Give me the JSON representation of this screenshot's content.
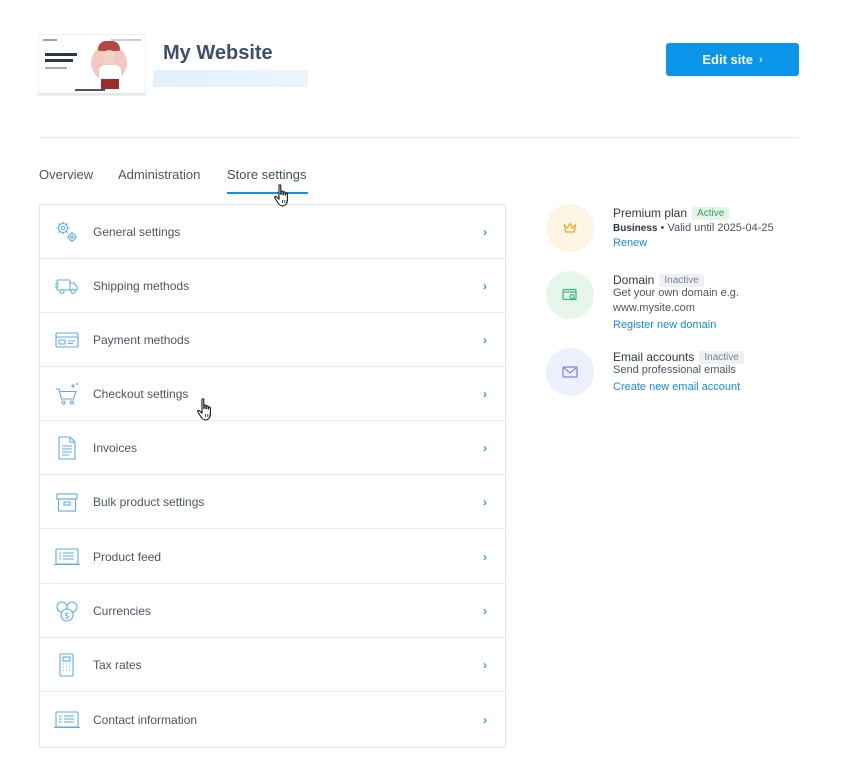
{
  "site": {
    "title": "My Website",
    "edit_button": "Edit site",
    "edit_chevron": "›"
  },
  "tabs": [
    {
      "label": "Overview",
      "active": false
    },
    {
      "label": "Administration",
      "active": false
    },
    {
      "label": "Store settings",
      "active": true
    }
  ],
  "settings": {
    "arrow": "›",
    "items": [
      {
        "label": "General settings",
        "icon": "gears-icon"
      },
      {
        "label": "Shipping methods",
        "icon": "truck-icon"
      },
      {
        "label": "Payment methods",
        "icon": "card-icon"
      },
      {
        "label": "Checkout settings",
        "icon": "cart-icon"
      },
      {
        "label": "Invoices",
        "icon": "document-icon"
      },
      {
        "label": "Bulk product settings",
        "icon": "box-icon"
      },
      {
        "label": "Product feed",
        "icon": "feed-icon"
      },
      {
        "label": "Currencies",
        "icon": "coins-icon"
      },
      {
        "label": "Tax rates",
        "icon": "calculator-icon"
      },
      {
        "label": "Contact information",
        "icon": "contact-card-icon"
      }
    ]
  },
  "features": {
    "premium": {
      "title": "Premium plan",
      "badge": "Active",
      "plan": "Business",
      "validity": "• Valid until 2025-04-25",
      "link": "Renew",
      "color": "#f5a623",
      "bg": "#fef4e4"
    },
    "domain": {
      "title": "Domain",
      "badge": "Inactive",
      "line1": "Get your own domain e.g.",
      "line2": "www.mysite.com",
      "link": "Register new domain",
      "color": "#3cb774",
      "bg": "#e6f6ec"
    },
    "email": {
      "title": "Email accounts",
      "badge": "Inactive",
      "line1": "Send professional emails",
      "link": "Create new email account",
      "color": "#7d84e0",
      "bg": "#eeeffc"
    }
  },
  "colors": {
    "accent": "#0a95e8",
    "link": "#1a8ad9"
  }
}
